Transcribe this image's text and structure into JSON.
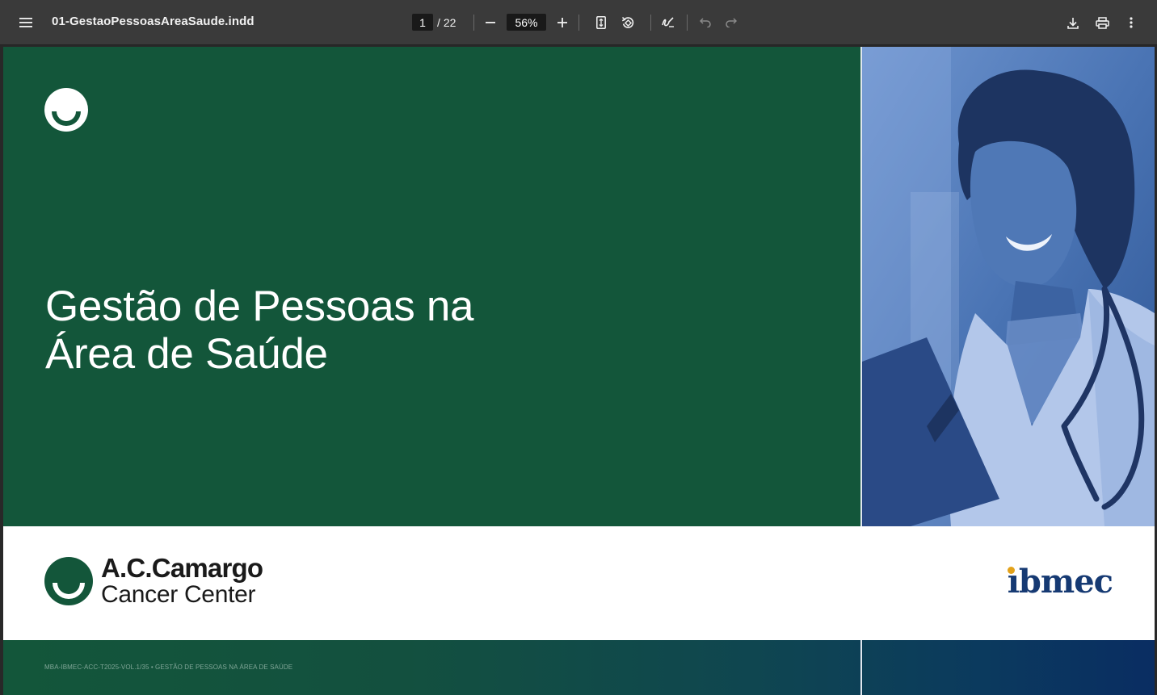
{
  "toolbar": {
    "menu_icon": "hamburger-menu-icon",
    "document_title": "01-GestaoPessoasAreaSaude.indd",
    "current_page": "1",
    "page_separator": "/",
    "total_pages": "22",
    "zoom_level": "56%",
    "icons": {
      "zoom_out": "minus-icon",
      "zoom_in": "plus-icon",
      "fit": "fit-to-page-icon",
      "rotate": "rotate-icon",
      "annotate": "draw-annotation-icon",
      "undo": "undo-icon",
      "redo": "redo-icon",
      "download": "download-icon",
      "print": "print-icon",
      "more": "more-vertical-icon"
    }
  },
  "cover": {
    "title_line1": "Gestão de Pessoas na",
    "title_line2": "Área de Saúde",
    "brand_name": "A.C.Camargo",
    "brand_sub": "Cancer Center",
    "partner_name": "ıbmec",
    "footer_code": "MBA-IBMEC-ACC-T2025-VOL.1/35 • GESTÃO DE PESSOAS NA ÁREA DE SAÚDE"
  },
  "colors": {
    "toolbar_bg": "#3a3a3a",
    "cover_green": "#13563a",
    "photo_blue": "#3f6aab",
    "ibmec_navy": "#163a73",
    "ibmec_accent": "#e3a21a"
  }
}
